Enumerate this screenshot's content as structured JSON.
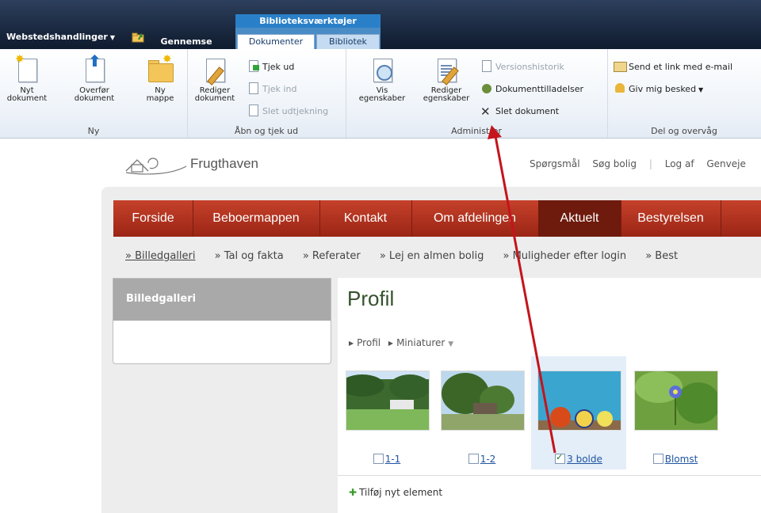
{
  "topbar": {
    "site_actions": "Webstedshandlinger",
    "contextual_label": "Biblioteksværktøjer",
    "tabs": {
      "browse": "Gennemse",
      "documents": "Dokumenter",
      "library": "Bibliotek"
    }
  },
  "ribbon": {
    "groups": {
      "new": {
        "label": "Ny",
        "new_doc": "Nyt dokument",
        "upload": "Overfør dokument",
        "new_folder": "Ny mappe"
      },
      "open": {
        "label": "Åbn og tjek ud",
        "edit_doc": "Rediger dokument",
        "check_out": "Tjek ud",
        "check_in": "Tjek ind",
        "discard": "Slet udtjekning"
      },
      "manage": {
        "label": "Administrer",
        "view_props": "Vis egenskaber",
        "edit_props": "Rediger egenskaber",
        "version_history": "Versionshistorik",
        "permissions": "Dokumenttilladelser",
        "delete": "Slet dokument"
      },
      "share": {
        "label": "Del og overvåg",
        "email_link": "Send et link med e-mail",
        "alert_me": "Giv mig besked"
      }
    }
  },
  "site": {
    "title": "Frugthaven",
    "toplinks": [
      "Spørgsmål",
      "Søg bolig",
      "Log af",
      "Genveje"
    ]
  },
  "mainnav": [
    "Forside",
    "Beboermappen",
    "Kontakt",
    "Om afdelingen",
    "Aktuelt",
    "Bestyrelsen"
  ],
  "subnav": [
    "» Billedgalleri",
    "» Tal og fakta",
    "» Referater",
    "» Lej en almen bolig",
    "» Muligheder efter login",
    "» Best"
  ],
  "left_panel": {
    "title": "Billedgalleri"
  },
  "content": {
    "title": "Profil",
    "breadcrumb": [
      "Profil",
      "Miniaturer"
    ],
    "items": [
      {
        "label": "1-1",
        "checked": false
      },
      {
        "label": "1-2",
        "checked": false
      },
      {
        "label": "3 bolde",
        "checked": true
      },
      {
        "label": "Blomst",
        "checked": false
      }
    ],
    "add_new": "Tilføj nyt element"
  },
  "colors": {
    "nav_red": "#b0331f",
    "active_nav": "#6e1a0d",
    "title_green": "#34522c",
    "ribbon_blue": "#2a80c8",
    "annotation_arrow": "#c4141c"
  }
}
